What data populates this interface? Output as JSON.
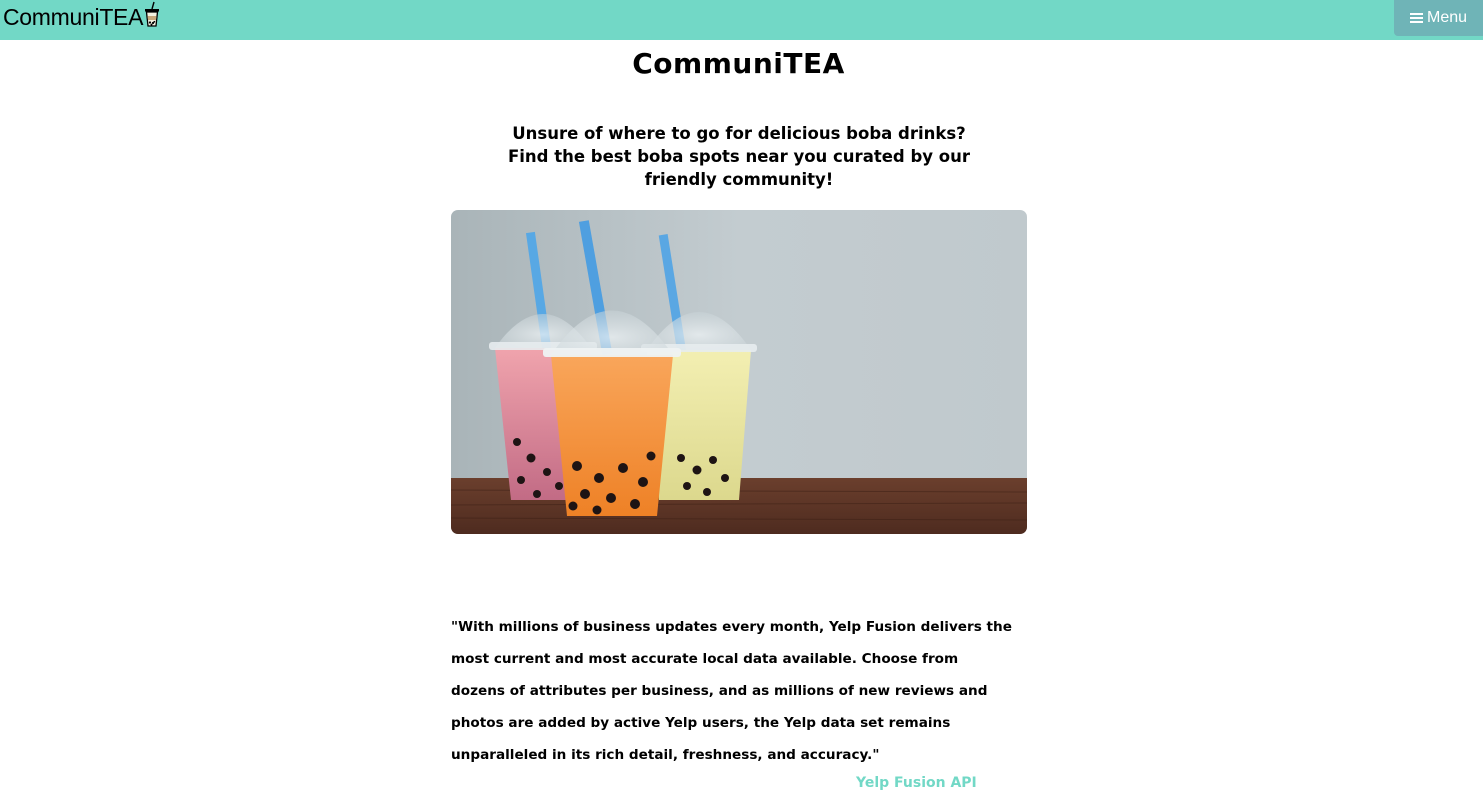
{
  "navbar": {
    "brand": "CommuniTEA",
    "menu_label": "Menu",
    "background": "#72d8c6",
    "menu_background": "#6fb4b7"
  },
  "main": {
    "title": "CommuniTEA",
    "tagline": "Unsure of where to go for delicious boba drinks? Find the best boba spots near you curated by our friendly community!",
    "hero_image": "boba-drinks-photo",
    "quote": "\"With millions of business updates every month, Yelp Fusion delivers the most current and most accurate local data available. Choose from dozens of attributes per business, and as millions of new reviews and photos are added by active Yelp users, the Yelp data set remains unparalleled in its rich detail, freshness, and accuracy.\"",
    "quote_source": "Yelp Fusion API"
  }
}
